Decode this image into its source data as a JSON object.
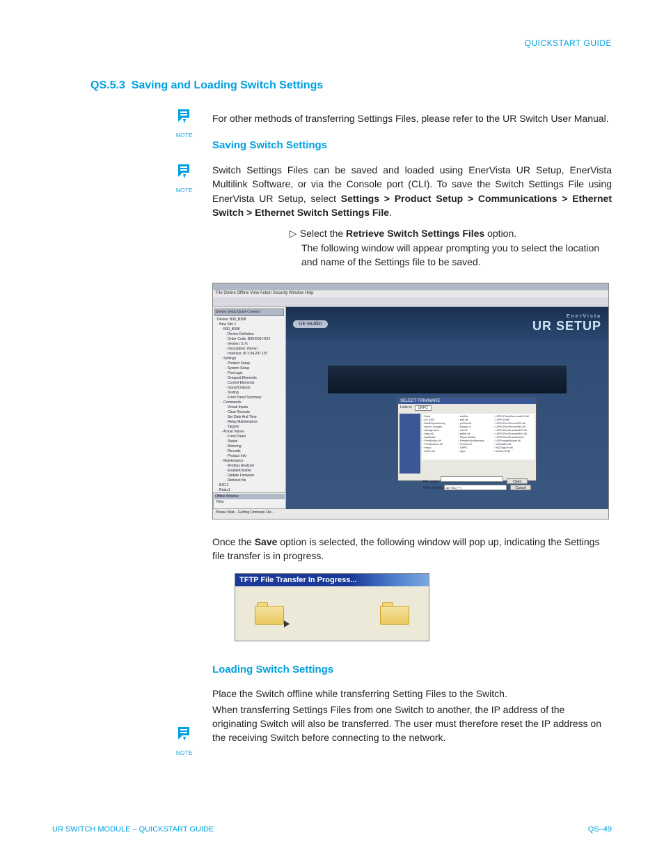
{
  "header": {
    "doc_type": "QUICKSTART GUIDE"
  },
  "section": {
    "number": "QS.5.3",
    "title": "Saving and Loading Switch Settings"
  },
  "note_label": "NOTE",
  "intro": "For other methods of transferring Settings Files, please refer to the UR Switch User Manual.",
  "saving": {
    "heading": "Saving Switch Settings",
    "p1_a": "Switch Settings Files can be saved and loaded using EnerVista UR Setup, EnerVista Multilink Software, or via the Console port (CLI).  To save the Switch Settings File using EnerVista UR Setup, select ",
    "p1_b": "Settings > Product Setup > Communications > Ethernet Switch > Ethernet Switch Settings File",
    "p1_c": ".",
    "step_a": "Select the ",
    "step_b": "Retrieve Switch Settings Files",
    "step_c": " option.",
    "step_follow": "The following window will appear prompting you to select the location and name of the Settings file to be saved.",
    "after_a": "Once the ",
    "after_b": "Save",
    "after_c": " option is selected, the following window will pop up, indicating the Settings file transfer is in progress."
  },
  "app": {
    "menu": "File  Online  Offline  View  Action  Security  Window  Help",
    "tree_head": "Device Setup    Quick Connect",
    "device_line": "Device:  B30_B308",
    "banner_badge": "GE Multilin",
    "banner_title": "UR SETUP",
    "banner_sub": "EnerVista",
    "tree": [
      "New Site 1",
      "B30_B308",
      "Device Definition",
      "Order Code: B30-E00-HCH",
      "Version: 5.7x",
      "Description: (None)",
      "Interface: IP 3.94.247.197",
      "Settings",
      "Product Setup",
      "System Setup",
      "FlexLogic",
      "Grouped Elements",
      "Control Elements",
      "Inputs/Outputs",
      "Testing",
      "Front Panel Summary",
      "Commands",
      "Virtual Inputs",
      "Clear Records",
      "Set Date And Time",
      "Relay Maintenance",
      "Targets",
      "Actual Values",
      "Front Panel",
      "Status",
      "Metering",
      "Records",
      "Product Info",
      "Maintenance",
      "Modbus Analyzer",
      "Enable/Disable",
      "Update Firmware",
      "Retrieve file",
      "B30-2",
      "Relay1"
    ],
    "tree_indent": [
      0,
      1,
      2,
      2,
      2,
      2,
      2,
      1,
      2,
      2,
      2,
      2,
      2,
      2,
      2,
      2,
      1,
      2,
      2,
      2,
      2,
      2,
      1,
      2,
      2,
      2,
      2,
      2,
      1,
      2,
      2,
      2,
      2,
      0,
      0
    ],
    "dialog": {
      "title": "SELECT FIRMWARE",
      "lookin_label": "Look in:",
      "lookin_value": "URPC",
      "files": [
        "Data",
        "D0_N03",
        "ModDependency",
        "report_images",
        "background",
        "drag.dll",
        "Egaldata",
        "FrmBlocks.dll",
        "FrmBlocks2.dll",
        "frmpc",
        "bcbrn.dll",
        "dmfbkr",
        "edit.dll",
        "jrcRes.dll",
        "lzense_b",
        "mh.dll",
        "pdfdll.dll",
        "ReportsData",
        "RetainedAddresses",
        "Tenderrsx",
        "URPC",
        "urpc",
        "URPCFlashNunoma920.dll",
        "URPCDWF",
        "URPCRunFrench920.dll",
        "URPCRunFrench940.dll",
        "URPCRunRussian920.dll",
        "URPCRunRussian940.dll",
        "URPCRunRussianSim...",
        "URXImageHelper.dll",
        "VistaIMDI.dll",
        "WQTagInfo.dll",
        "wmGLnP.dll"
      ],
      "filename_label": "File name:",
      "filetype_label": "Files of type:",
      "filetype_value": "All Files (*.*)",
      "open": "Open",
      "cancel": "Cancel"
    },
    "offline_title": "Offline Window",
    "offline_item": "Files",
    "status": "Please Wait...  Getting Firmware File..."
  },
  "tftp": {
    "title": "TFTP File Transfer In Progress..."
  },
  "loading": {
    "heading": "Loading Switch Settings",
    "p1": "Place the Switch offline while transferring Setting Files to the Switch.",
    "p2": "When transferring Settings Files from one Switch to another, the IP address of the originating Switch will also be transferred. The user must therefore reset the IP address on the receiving Switch before connecting to the network."
  },
  "footer": {
    "left": "UR SWITCH MODULE – QUICKSTART GUIDE",
    "right": "QS–49"
  }
}
